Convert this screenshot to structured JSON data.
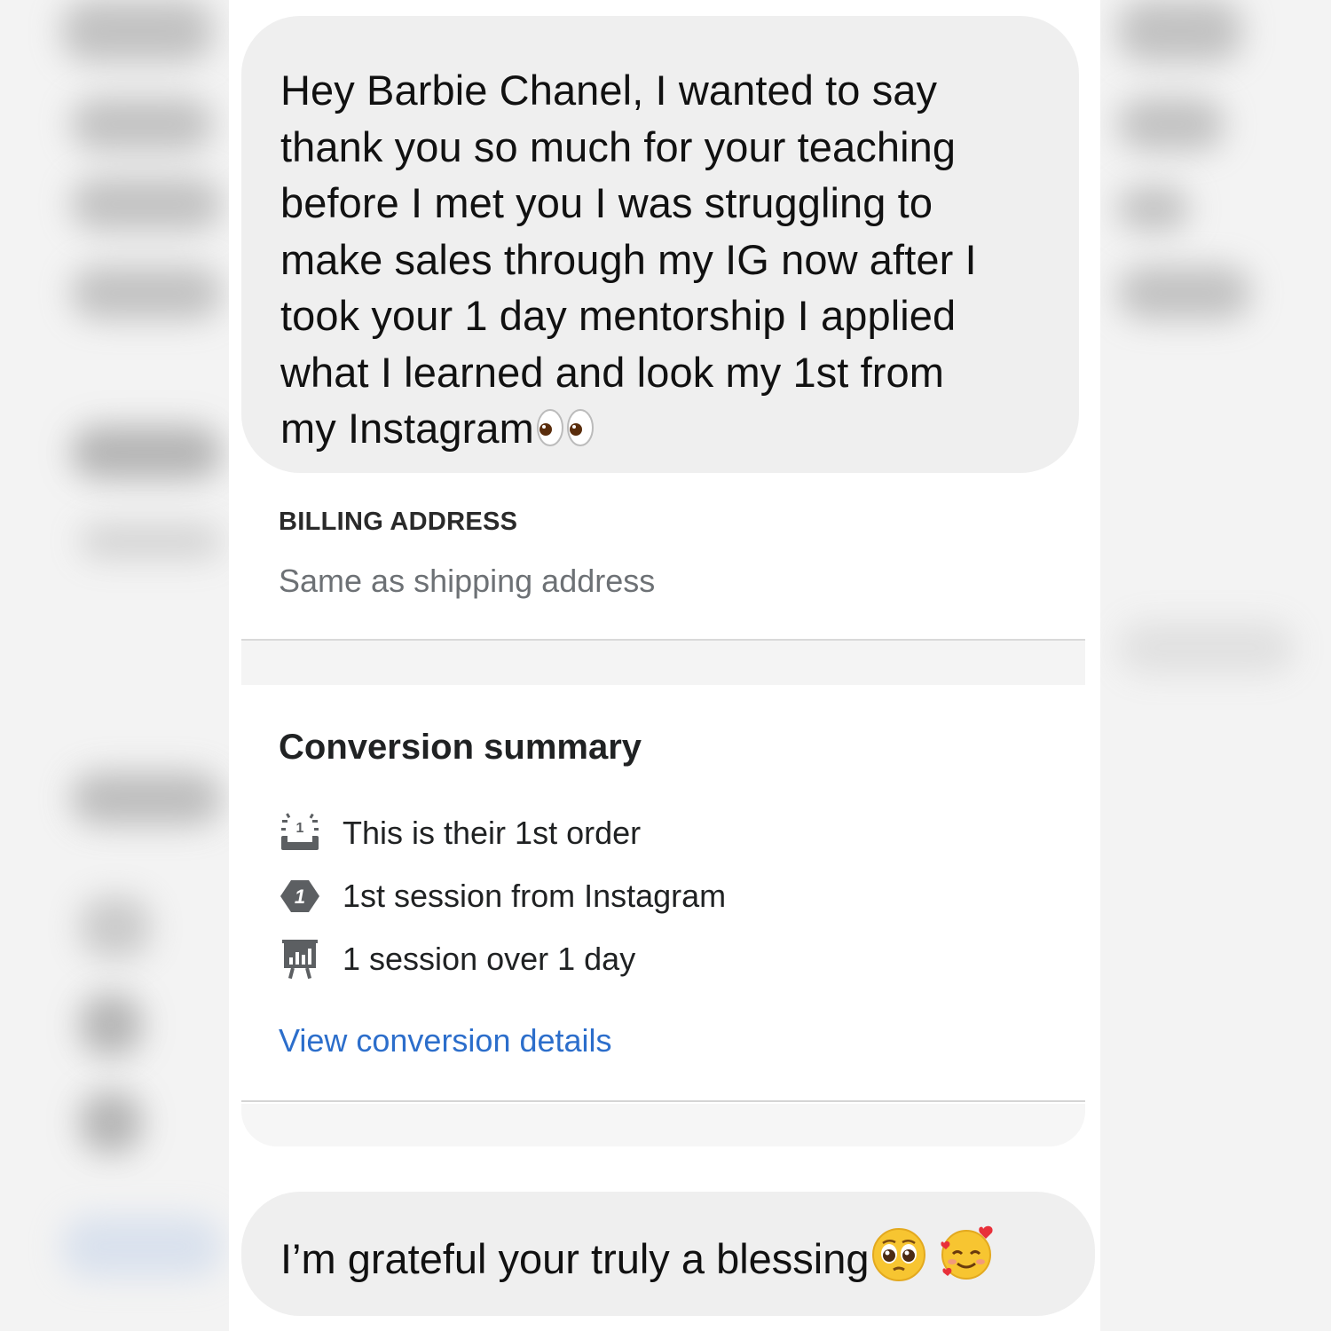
{
  "messages": {
    "top_lines": [
      "Hey Barbie Chanel, I wanted to say",
      "thank you so much for your teaching",
      "before I met you I was struggling to",
      "make sales through my IG now after I",
      "took your 1 day mentorship I applied",
      "what I learned and look my 1st from",
      "my Instagram"
    ],
    "top_emoji": "eyes-emoji",
    "bottom_text": "I’m grateful your truly a blessing",
    "bottom_emojis": [
      "pleading-face-emoji",
      "smiling-face-with-hearts-emoji"
    ]
  },
  "billing": {
    "label": "BILLING ADDRESS",
    "value": "Same as shipping address"
  },
  "conversion": {
    "title": "Conversion summary",
    "rows": [
      {
        "icon": "first-order-icon",
        "text": "This is their 1st order"
      },
      {
        "icon": "session-number-icon",
        "text": "1st session from Instagram"
      },
      {
        "icon": "presentation-chart-icon",
        "text": "1 session over 1 day"
      }
    ],
    "link": "View conversion details"
  },
  "colors": {
    "bubble": "#efefef",
    "link": "#2c6ecb",
    "muted_text": "#6d7175"
  }
}
